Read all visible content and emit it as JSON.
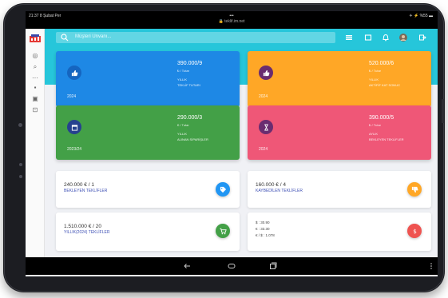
{
  "statusbar": {
    "time": "21:37",
    "carrier": "8 Şubat Per",
    "dots": "•••",
    "url": "🔒 teklif.im.net",
    "right": "✈ ⚡ %55 ▬"
  },
  "search": {
    "placeholder": "Müşteri Unvanı..."
  },
  "cards": [
    {
      "value": "390.000/9",
      "sub": "₺ / Tutar",
      "cap1": "YILLIK",
      "cap2": "TEKLİF TUTARI",
      "year": "2024",
      "color": "#1e88e5",
      "circle": "#1565c0",
      "icon": "thumbs-up-icon"
    },
    {
      "value": "520.000/6",
      "sub": "₺ / Tutar",
      "cap1": "YILLIK",
      "cap2": "AKTİFİF KAT SONUC",
      "year": "2024",
      "color": "#ffa726",
      "circle": "#6a2c70",
      "icon": "thumbs-up-icon"
    },
    {
      "value": "290.000/3",
      "sub": "€ / Tutar",
      "cap1": "YILLIK",
      "cap2": "ALINAN SİPARİŞLER",
      "year": "2023/24",
      "color": "#43a047",
      "circle": "#26418f",
      "icon": "calendar-icon"
    },
    {
      "value": "390.000/5",
      "sub": "₺ / Tutar",
      "cap1": "AYLIK",
      "cap2": "BEKLEYEN TEKLİFLER",
      "year": "2024",
      "color": "#ef5777",
      "circle": "#6a2c70",
      "icon": "hourglass-icon"
    }
  ],
  "panels": [
    {
      "amount": "240.000 € / 1",
      "label": "BEKLEYEN TEKLİFLER",
      "color": "#2196f3",
      "icon": "tag-icon"
    },
    {
      "amount": "160.000 € / 4",
      "label": "KAYBEDİLEN TEKLİFLER",
      "color": "#ffa726",
      "icon": "thumbs-down-icon"
    },
    {
      "amount": "1.510.000 € / 20",
      "label": "YILLIK(2024) TEKLİFLER",
      "color": "#43a047",
      "icon": "cart-icon"
    }
  ],
  "rates": {
    "usd": "$  : 30.90",
    "eur": "€  : 33.30",
    "cross": "€ / $  : 1.078",
    "color": "#ef5350",
    "icon": "dollar-icon"
  }
}
